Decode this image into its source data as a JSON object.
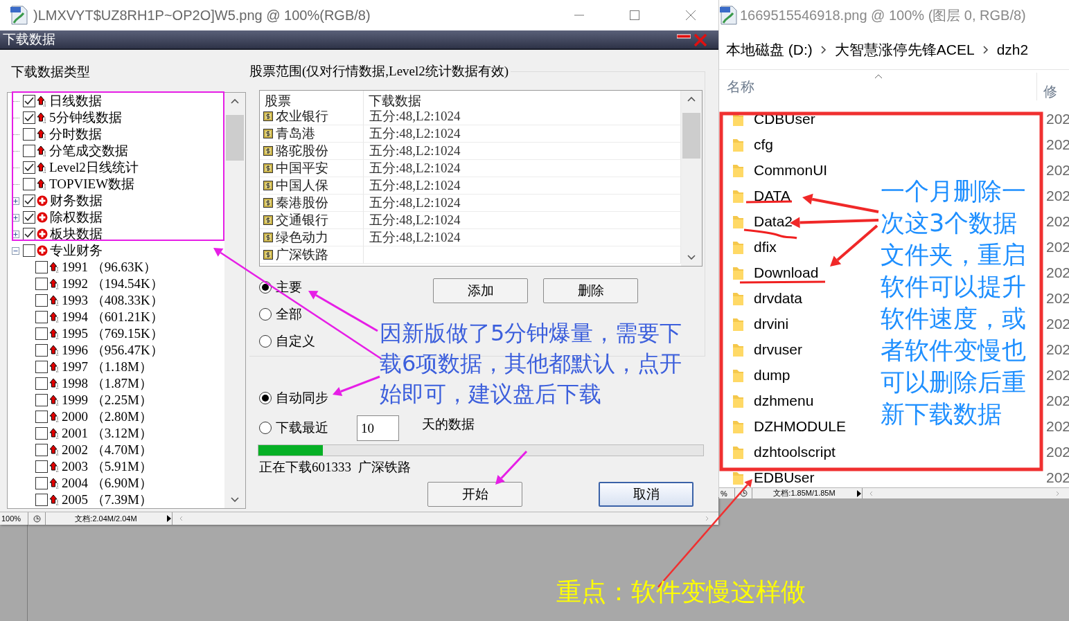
{
  "doc_window": {
    "title": ")LMXVYT$UZ8RH1P~OP2O]W5.png @ 100%(RGB/8)",
    "status": {
      "zoom": "100%",
      "doc": "文档:2.04M/2.04M"
    }
  },
  "dialog": {
    "title": "下载数据",
    "types_label": "下载数据类型",
    "tree": [
      {
        "label": "日线数据",
        "checked": true,
        "kind": "item"
      },
      {
        "label": "5分钟线数据",
        "checked": true,
        "kind": "item"
      },
      {
        "label": "分时数据",
        "checked": false,
        "kind": "item"
      },
      {
        "label": "分笔成交数据",
        "checked": false,
        "kind": "item"
      },
      {
        "label": "Level2日线统计",
        "checked": true,
        "kind": "item"
      },
      {
        "label": "TOPVIEW数据",
        "checked": false,
        "kind": "item"
      },
      {
        "label": "财务数据",
        "checked": true,
        "kind": "group",
        "expanded": false
      },
      {
        "label": "除权数据",
        "checked": true,
        "kind": "group",
        "expanded": false
      },
      {
        "label": "板块数据",
        "checked": true,
        "kind": "group",
        "expanded": false
      },
      {
        "label": "专业财务",
        "checked": false,
        "kind": "group",
        "expanded": true,
        "children": [
          {
            "label": "1991 （96.63K）",
            "checked": false,
            "kind": "item"
          },
          {
            "label": "1992 （194.54K）",
            "checked": false,
            "kind": "item"
          },
          {
            "label": "1993 （408.33K）",
            "checked": false,
            "kind": "item"
          },
          {
            "label": "1994 （601.21K）",
            "checked": false,
            "kind": "item"
          },
          {
            "label": "1995 （769.15K）",
            "checked": false,
            "kind": "item"
          },
          {
            "label": "1996 （956.47K）",
            "checked": false,
            "kind": "item"
          },
          {
            "label": "1997 （1.18M）",
            "checked": false,
            "kind": "item"
          },
          {
            "label": "1998 （1.87M）",
            "checked": false,
            "kind": "item"
          },
          {
            "label": "1999 （2.25M）",
            "checked": false,
            "kind": "item"
          },
          {
            "label": "2000 （2.80M）",
            "checked": false,
            "kind": "item"
          },
          {
            "label": "2001 （3.12M）",
            "checked": false,
            "kind": "item"
          },
          {
            "label": "2002 （4.70M）",
            "checked": false,
            "kind": "item"
          },
          {
            "label": "2003 （5.91M）",
            "checked": false,
            "kind": "item"
          },
          {
            "label": "2004 （6.90M）",
            "checked": false,
            "kind": "item"
          },
          {
            "label": "2005 （7.39M）",
            "checked": false,
            "kind": "item"
          }
        ]
      }
    ],
    "range_label": "股票范围(仅对行情数据,Level2统计数据有效)",
    "table": {
      "columns": [
        "股票",
        "下载数据"
      ],
      "rows": [
        {
          "stock": "农业银行",
          "data": "五分:48,L2:1024"
        },
        {
          "stock": "青岛港",
          "data": "五分:48,L2:1024"
        },
        {
          "stock": "骆驼股份",
          "data": "五分:48,L2:1024"
        },
        {
          "stock": "中国平安",
          "data": "五分:48,L2:1024"
        },
        {
          "stock": "中国人保",
          "data": "五分:48,L2:1024"
        },
        {
          "stock": "秦港股份",
          "data": "五分:48,L2:1024"
        },
        {
          "stock": "交通银行",
          "data": "五分:48,L2:1024"
        },
        {
          "stock": "绿色动力",
          "data": "五分:48,L2:1024"
        },
        {
          "stock": "广深铁路"
        }
      ]
    },
    "scope_options": [
      {
        "label": "主要",
        "selected": true
      },
      {
        "label": "全部",
        "selected": false
      },
      {
        "label": "自定义",
        "selected": false
      }
    ],
    "list_buttons": [
      "添加",
      "删除"
    ],
    "mode_options": [
      {
        "label": "自动同步",
        "selected": true
      },
      {
        "label": "下载最近",
        "selected": false
      }
    ],
    "days_field": {
      "value": "10"
    },
    "days_suffix": "天的数据",
    "progress": {
      "level": 0.145
    },
    "status_text": "正在下载601333  广深铁路",
    "start_button": "开始",
    "cancel_button": "取消"
  },
  "explorer": {
    "title": "1669515546918.png @ 100% (图层 0, RGB/8)",
    "breadcrumb": [
      "本地磁盘 (D:)",
      "大智慧涨停先锋ACEL",
      "dzh2"
    ],
    "columns": [
      "名称",
      "修"
    ],
    "rows": [
      {
        "name": "CDBUser",
        "date": "202"
      },
      {
        "name": "cfg",
        "date": "202"
      },
      {
        "name": "CommonUI",
        "date": "202"
      },
      {
        "name": "DATA",
        "date": "202"
      },
      {
        "name": "Data2",
        "date": "202"
      },
      {
        "name": "dfix",
        "date": "202"
      },
      {
        "name": "Download",
        "date": "202"
      },
      {
        "name": "drvdata",
        "date": "202"
      },
      {
        "name": "drvini",
        "date": "202"
      },
      {
        "name": "drvuser",
        "date": "202"
      },
      {
        "name": "dump",
        "date": "202"
      },
      {
        "name": "dzhmenu",
        "date": "202"
      },
      {
        "name": "DZHMODULE",
        "date": "202"
      },
      {
        "name": "dzhtoolscript",
        "date": "202"
      },
      {
        "name": "EDBUser",
        "date": "202"
      }
    ],
    "status": {
      "zoom": "%",
      "doc": "文档:1.85M/1.85M"
    }
  },
  "notes": [
    {
      "text": "因新版做了5分钟爆量，需要下载6项数据，其他都默认，点开始即可，建议盘后下载",
      "color": "#3c5fdc"
    },
    {
      "text": "一个月删除一次这3个数据文件夹，重启软件可以提升软件速度，或者软件变慢也可以删除后重新下载数据",
      "color": "#1e8fff"
    },
    {
      "text": "重点：软件变慢这样做",
      "color": "#ffff00"
    }
  ]
}
